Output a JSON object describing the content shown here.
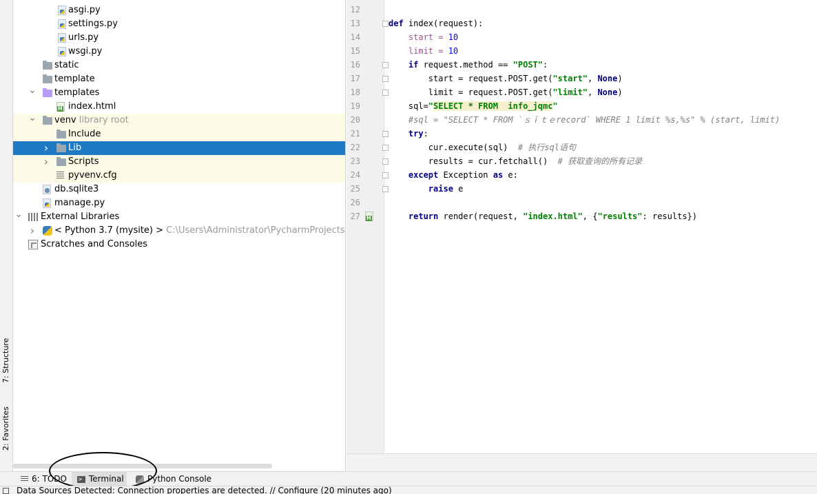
{
  "left_strip": {
    "structure_label": "7: Structure",
    "favorites_label": "2: Favorites"
  },
  "tree": [
    {
      "label": "asgi.py",
      "hint": "",
      "icon": "python-file-icon"
    },
    {
      "label": "settings.py",
      "hint": "",
      "icon": "python-file-icon"
    },
    {
      "label": "urls.py",
      "hint": "",
      "icon": "python-file-icon"
    },
    {
      "label": "wsgi.py",
      "hint": "",
      "icon": "python-file-icon"
    },
    {
      "label": "static",
      "hint": "",
      "icon": "folder-icon"
    },
    {
      "label": "template",
      "hint": "",
      "icon": "folder-icon"
    },
    {
      "label": "templates",
      "hint": "",
      "icon": "templates-folder-icon"
    },
    {
      "label": "index.html",
      "hint": "",
      "icon": "html-file-icon"
    },
    {
      "label": "venv",
      "hint": "library root",
      "icon": "folder-icon"
    },
    {
      "label": "Include",
      "hint": "",
      "icon": "folder-icon"
    },
    {
      "label": "Lib",
      "hint": "",
      "icon": "folder-icon"
    },
    {
      "label": "Scripts",
      "hint": "",
      "icon": "folder-icon"
    },
    {
      "label": "pyvenv.cfg",
      "hint": "",
      "icon": "config-file-icon"
    },
    {
      "label": "db.sqlite3",
      "hint": "",
      "icon": "database-file-icon"
    },
    {
      "label": "manage.py",
      "hint": "",
      "icon": "python-file-icon"
    },
    {
      "label": "External Libraries",
      "hint": "",
      "icon": "libraries-icon"
    },
    {
      "label": "< Python 3.7 (mysite) >",
      "hint": "C:\\Users\\Administrator\\PycharmProjects\\mysite\\",
      "icon": "python-sdk-icon"
    },
    {
      "label": "Scratches and Consoles",
      "hint": "",
      "icon": "scratches-icon"
    }
  ],
  "editor": {
    "line_numbers": [
      "12",
      "13",
      "14",
      "15",
      "16",
      "17",
      "18",
      "19",
      "20",
      "21",
      "22",
      "23",
      "24",
      "25",
      "26",
      "27"
    ],
    "lines": [
      [],
      [
        {
          "t": "def",
          "c": "kw"
        },
        {
          "t": " index(request):",
          "c": ""
        }
      ],
      [
        {
          "t": "    start = ",
          "c": "param"
        },
        {
          "t": "10",
          "c": "num"
        }
      ],
      [
        {
          "t": "    limit = ",
          "c": "param"
        },
        {
          "t": "10",
          "c": "num"
        }
      ],
      [
        {
          "t": "    ",
          "c": ""
        },
        {
          "t": "if",
          "c": "kw"
        },
        {
          "t": " request.method == ",
          "c": ""
        },
        {
          "t": "\"POST\"",
          "c": "str"
        },
        {
          "t": ":",
          "c": ""
        }
      ],
      [
        {
          "t": "        start = request.POST.get(",
          "c": ""
        },
        {
          "t": "\"start\"",
          "c": "str"
        },
        {
          "t": ", ",
          "c": ""
        },
        {
          "t": "None",
          "c": "kw"
        },
        {
          "t": ")",
          "c": ""
        }
      ],
      [
        {
          "t": "        limit = request.POST.get(",
          "c": ""
        },
        {
          "t": "\"limit\"",
          "c": "str"
        },
        {
          "t": ", ",
          "c": ""
        },
        {
          "t": "None",
          "c": "kw"
        },
        {
          "t": ")",
          "c": ""
        }
      ],
      [
        {
          "t": "    sql=",
          "c": ""
        },
        {
          "t": "\"",
          "c": "str"
        },
        {
          "t": "SELECT * FROM  info_jqmc",
          "c": "str sqlhl"
        },
        {
          "t": "\"",
          "c": "str"
        }
      ],
      [
        {
          "t": "    #sql = \"SELECT * FROM `ｓｉｔｅrecord` WHERE 1 limit %s,%s\" % (start, limit)",
          "c": "cmt"
        }
      ],
      [
        {
          "t": "    ",
          "c": ""
        },
        {
          "t": "try",
          "c": "kw"
        },
        {
          "t": ":",
          "c": ""
        }
      ],
      [
        {
          "t": "        cur.execute(sql)  ",
          "c": ""
        },
        {
          "t": "# 执行sql语句",
          "c": "cmt"
        }
      ],
      [
        {
          "t": "        results = cur.fetchall()  ",
          "c": ""
        },
        {
          "t": "# 获取查询的所有记录",
          "c": "cmt"
        }
      ],
      [
        {
          "t": "    ",
          "c": ""
        },
        {
          "t": "except",
          "c": "kw"
        },
        {
          "t": " Exception ",
          "c": ""
        },
        {
          "t": "as",
          "c": "kw"
        },
        {
          "t": " e:",
          "c": ""
        }
      ],
      [
        {
          "t": "        ",
          "c": ""
        },
        {
          "t": "raise",
          "c": "kw"
        },
        {
          "t": " e",
          "c": ""
        }
      ],
      [],
      [
        {
          "t": "    ",
          "c": ""
        },
        {
          "t": "return",
          "c": "kw"
        },
        {
          "t": " render(request, ",
          "c": ""
        },
        {
          "t": "\"index.html\"",
          "c": "str"
        },
        {
          "t": ", {",
          "c": ""
        },
        {
          "t": "\"results\"",
          "c": "str"
        },
        {
          "t": ": results})",
          "c": ""
        }
      ]
    ]
  },
  "bottom_tabs": {
    "todo": "6: TODO",
    "terminal": "Terminal",
    "python_console": "Python Console"
  },
  "status": {
    "message": "Data Sources Detected: Connection properties are detected. // Configure (20 minutes ago)"
  }
}
